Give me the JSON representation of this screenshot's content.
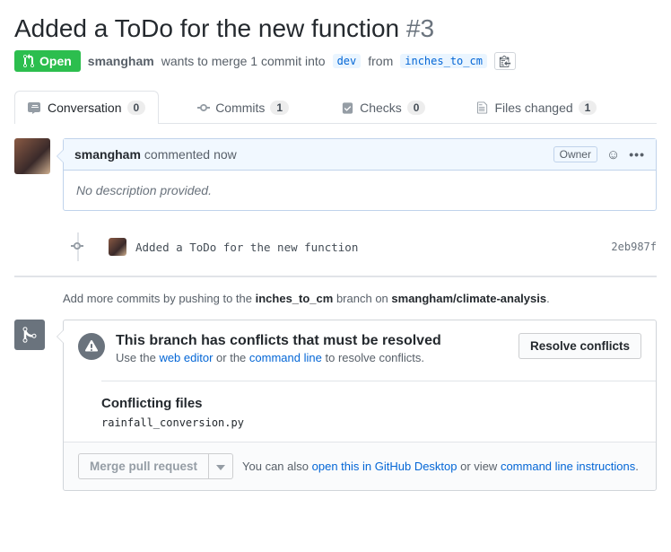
{
  "title": "Added a ToDo for the new function",
  "issue_number": "#3",
  "state": "Open",
  "author": "smangham",
  "merge_phrase_1": "wants to merge 1 commit into",
  "base_branch": "dev",
  "merge_phrase_2": "from",
  "head_branch": "inches_to_cm",
  "tabs": {
    "conversation": {
      "label": "Conversation",
      "count": "0"
    },
    "commits": {
      "label": "Commits",
      "count": "1"
    },
    "checks": {
      "label": "Checks",
      "count": "0"
    },
    "files": {
      "label": "Files changed",
      "count": "1"
    }
  },
  "comment": {
    "author": "smangham",
    "action": "commented",
    "time": "now",
    "owner_label": "Owner",
    "body": "No description provided."
  },
  "commit": {
    "message": "Added a ToDo for the new function",
    "sha": "2eb987f"
  },
  "push_hint_1": "Add more commits by pushing to the",
  "push_hint_branch": "inches_to_cm",
  "push_hint_2": "branch on",
  "push_hint_repo": "smangham/climate-analysis",
  "merge_panel": {
    "title": "This branch has conflicts that must be resolved",
    "sub_prefix": "Use the",
    "web_editor": "web editor",
    "sub_mid": "or the",
    "command_line": "command line",
    "sub_suffix": "to resolve conflicts.",
    "resolve_btn": "Resolve conflicts",
    "conflicting_title": "Conflicting files",
    "conflicting_file": "rainfall_conversion.py"
  },
  "merge_footer": {
    "button": "Merge pull request",
    "text_1": "You can also",
    "link_desktop": "open this in GitHub Desktop",
    "text_2": "or view",
    "link_cli": "command line instructions"
  }
}
